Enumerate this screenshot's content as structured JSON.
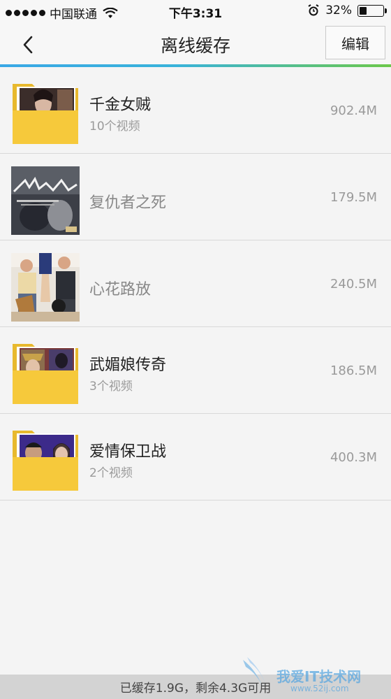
{
  "status_bar": {
    "carrier": "中国联通",
    "time": "下午3:31",
    "battery": "32%",
    "battery_level": 0.32
  },
  "nav": {
    "title": "离线缓存",
    "edit_label": "编辑",
    "accent_colors": [
      "#3aa8e6",
      "#6cc84a"
    ]
  },
  "items": [
    {
      "title": "千金女贼",
      "subtitle": "10个视频",
      "size": "902.4M",
      "thumb": "folder"
    },
    {
      "title": "复仇者之死",
      "subtitle": "",
      "size": "179.5M",
      "thumb": "poster"
    },
    {
      "title": "心花路放",
      "subtitle": "",
      "size": "240.5M",
      "thumb": "poster"
    },
    {
      "title": "武媚娘传奇",
      "subtitle": "3个视频",
      "size": "186.5M",
      "thumb": "folder"
    },
    {
      "title": "爱情保卫战",
      "subtitle": "2个视频",
      "size": "400.3M",
      "thumb": "folder"
    }
  ],
  "footer": {
    "storage_text": "已缓存1.9G，剩余4.3G可用"
  },
  "watermark": {
    "text": "我爱IT技术网",
    "url": "www.52ij.com"
  }
}
